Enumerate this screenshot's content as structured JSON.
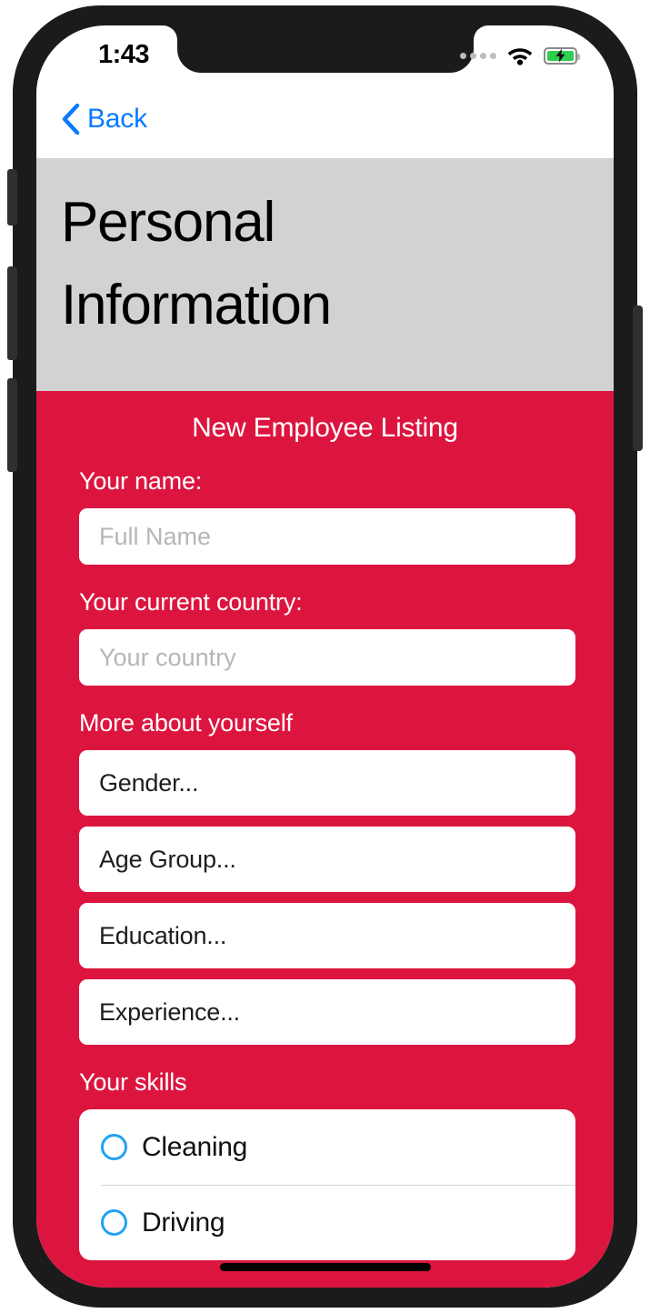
{
  "status_bar": {
    "time": "1:43",
    "cellular_icon": "signal-dots-icon",
    "wifi_icon": "wifi-icon",
    "battery_icon": "battery-charging-icon",
    "battery_state": "charging"
  },
  "nav": {
    "back_label": "Back",
    "back_icon": "chevron-left-icon",
    "accent_color": "#0a7aff"
  },
  "header": {
    "title": "Personal Information",
    "background_color": "#d2d2d2"
  },
  "form": {
    "title": "New Employee Listing",
    "background_color": "#dc153f",
    "fields": [
      {
        "label": "Your name:",
        "placeholder": "Full Name",
        "value": ""
      },
      {
        "label": "Your current country:",
        "placeholder": "Your country",
        "value": ""
      }
    ],
    "selects_heading": "More about yourself",
    "selects": [
      {
        "label": "Gender..."
      },
      {
        "label": "Age Group..."
      },
      {
        "label": "Education..."
      },
      {
        "label": "Experience..."
      }
    ],
    "skills_heading": "Your skills",
    "skills": [
      {
        "label": "Cleaning",
        "selected": false
      },
      {
        "label": "Driving",
        "selected": false
      }
    ],
    "radio_color": "#22a2f2"
  }
}
